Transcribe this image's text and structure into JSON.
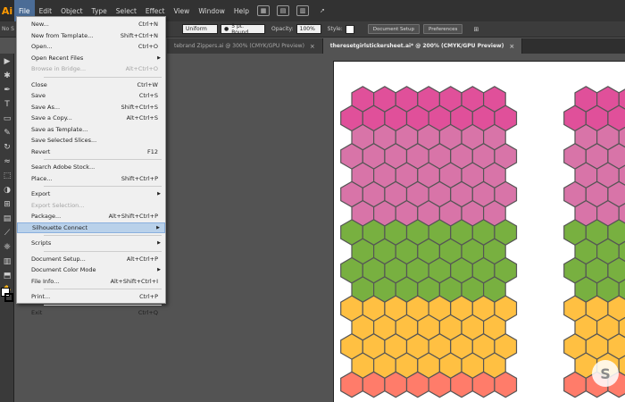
{
  "app": {
    "logo": "Ai"
  },
  "menubar": {
    "items": [
      "File",
      "Edit",
      "Object",
      "Type",
      "Select",
      "Effect",
      "View",
      "Window",
      "Help"
    ]
  },
  "controlbar": {
    "selection": "No S",
    "stroke_profile": "Uniform",
    "brush": "5 pt. Round",
    "opacity_label": "Opacity:",
    "opacity_value": "100%",
    "style_label": "Style:",
    "doc_setup": "Document Setup",
    "preferences": "Preferences"
  },
  "tabs": [
    {
      "label": "tebrand Zippers.ai @ 300% (CMYK/GPU Preview)",
      "close": "×"
    },
    {
      "label": "theresetgirlstickersheet.ai* @ 200% (CMYK/GPU Preview)",
      "close": "×"
    }
  ],
  "file_menu": {
    "items": [
      {
        "label": "New...",
        "shortcut": "Ctrl+N"
      },
      {
        "label": "New from Template...",
        "shortcut": "Shift+Ctrl+N"
      },
      {
        "label": "Open...",
        "shortcut": "Ctrl+O"
      },
      {
        "label": "Open Recent Files",
        "arrow": "▶"
      },
      {
        "label": "Browse in Bridge...",
        "shortcut": "Alt+Ctrl+O",
        "disabled": true
      },
      {
        "sep": true
      },
      {
        "label": "Close",
        "shortcut": "Ctrl+W"
      },
      {
        "label": "Save",
        "shortcut": "Ctrl+S"
      },
      {
        "label": "Save As...",
        "shortcut": "Shift+Ctrl+S"
      },
      {
        "label": "Save a Copy...",
        "shortcut": "Alt+Ctrl+S"
      },
      {
        "label": "Save as Template..."
      },
      {
        "label": "Save Selected Slices..."
      },
      {
        "label": "Revert",
        "shortcut": "F12"
      },
      {
        "sep": true
      },
      {
        "label": "Search Adobe Stock..."
      },
      {
        "label": "Place...",
        "shortcut": "Shift+Ctrl+P"
      },
      {
        "sep": true
      },
      {
        "label": "Export",
        "arrow": "▶"
      },
      {
        "label": "Export Selection...",
        "disabled": true
      },
      {
        "label": "Package...",
        "shortcut": "Alt+Shift+Ctrl+P"
      },
      {
        "label": "Silhouette Connect",
        "arrow": "▶",
        "hover": true
      },
      {
        "sep": true
      },
      {
        "label": "Scripts",
        "arrow": "▶"
      },
      {
        "sep": true
      },
      {
        "label": "Document Setup...",
        "shortcut": "Alt+Ctrl+P"
      },
      {
        "label": "Document Color Mode",
        "arrow": "▶"
      },
      {
        "label": "File Info...",
        "shortcut": "Alt+Shift+Ctrl+I"
      },
      {
        "sep": true
      },
      {
        "label": "Print...",
        "shortcut": "Ctrl+P"
      },
      {
        "sep": true
      },
      {
        "label": "Exit",
        "shortcut": "Ctrl+Q"
      }
    ]
  },
  "artwork": {
    "row_colors": [
      "#e0509a",
      "#e0509a",
      "#d874a8",
      "#d874a8",
      "#d874a8",
      "#d874a8",
      "#d874a8",
      "#78b040",
      "#78b040",
      "#78b040",
      "#78b040",
      "#ffc042",
      "#ffc042",
      "#ffc042",
      "#ffc042",
      "#ff7c6a"
    ],
    "stroke_color": "#555555"
  },
  "watermark": {
    "glyph": "S"
  }
}
